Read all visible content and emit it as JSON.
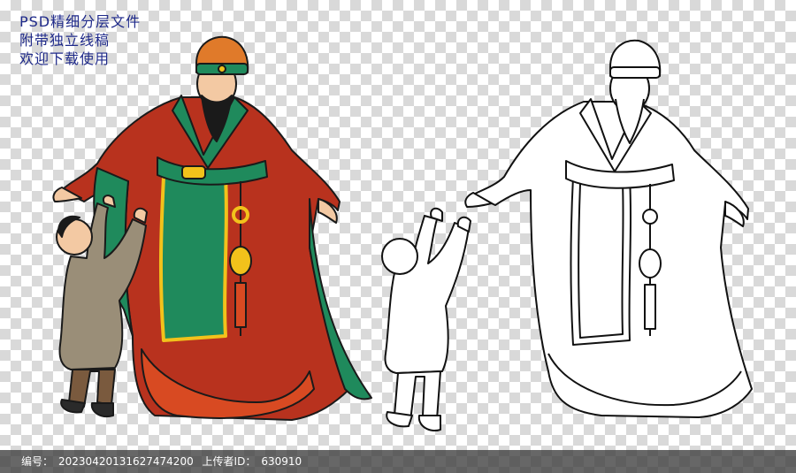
{
  "caption": {
    "line1": "PSD精细分层文件",
    "line2": "附带独立线稿",
    "line3": "欢迎下载使用"
  },
  "footer": {
    "id_label": "编号：",
    "id_value": "20230420131627474200",
    "uploader_label": "上传者ID：",
    "uploader_value": "630910"
  },
  "colors": {
    "robe": "#b8321e",
    "sash": "#1f8a5c",
    "gold": "#f2c21b",
    "hat": "#e07a2a",
    "skin": "#f3c9a3",
    "child_clothes": "#9a8e78",
    "line": "#111111"
  }
}
